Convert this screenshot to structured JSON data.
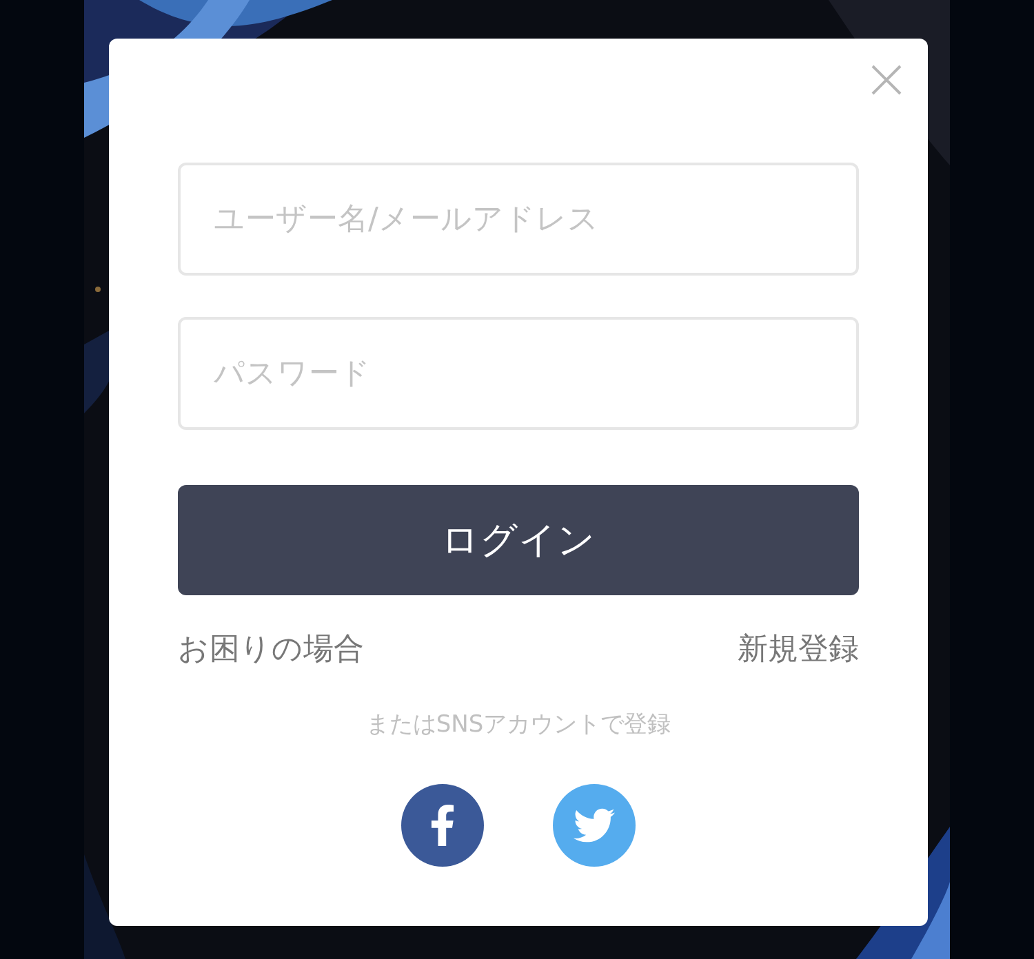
{
  "dialog": {
    "fields": [
      {
        "placeholder": "ユーザー名/メールアドレス"
      },
      {
        "placeholder": "パスワード"
      }
    ],
    "login_button": "ログイン",
    "links": [
      {
        "label": "お困りの場合"
      },
      {
        "label": "新規登録"
      }
    ],
    "sns_caption": "またはSNSアカウントで登録",
    "sns_buttons": [
      {
        "kind": "facebook",
        "color": "#3b5998"
      },
      {
        "kind": "twitter",
        "color": "#55acee"
      }
    ]
  }
}
